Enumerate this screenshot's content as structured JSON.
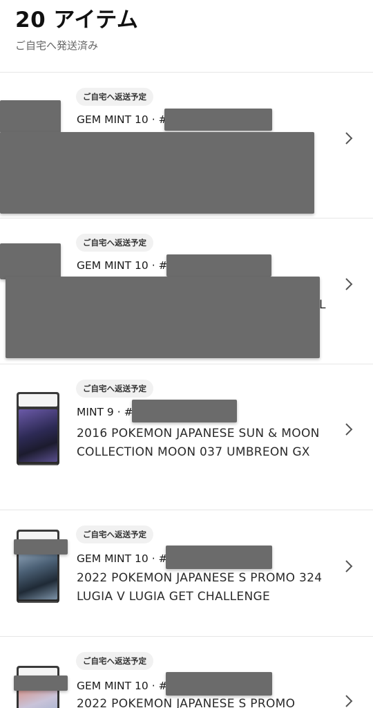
{
  "header": {
    "title": "20 アイテム",
    "subtitle": "ご自宅へ発送済み"
  },
  "items": [
    {
      "badge": "ご自宅へ返送予定",
      "grade": "GEM MINT 10 · #",
      "name": ""
    },
    {
      "badge": "ご自宅へ返送予定",
      "grade": "GEM MINT 10 · #",
      "name": "L"
    },
    {
      "badge": "ご自宅へ返送予定",
      "grade": "MINT 9 · #",
      "name": "2016 POKEMON JAPANESE SUN & MOON COLLECTION MOON 037 UMBREON GX"
    },
    {
      "badge": "ご自宅へ返送予定",
      "grade": "GEM MINT 10 · #",
      "name": "2022 POKEMON JAPANESE S PROMO 324 LUGIA V LUGIA GET CHALLENGE"
    },
    {
      "badge": "ご自宅へ返送予定",
      "grade": "GEM MINT 10 · #",
      "name": "2022 POKEMON JAPANESE S PROMO"
    }
  ],
  "icons": {
    "row_action": "chevron-right-icon"
  },
  "colors": {
    "redaction": "#6b6b6b",
    "badge_bg": "#f1f1f1",
    "divider": "#e6e6e6"
  }
}
